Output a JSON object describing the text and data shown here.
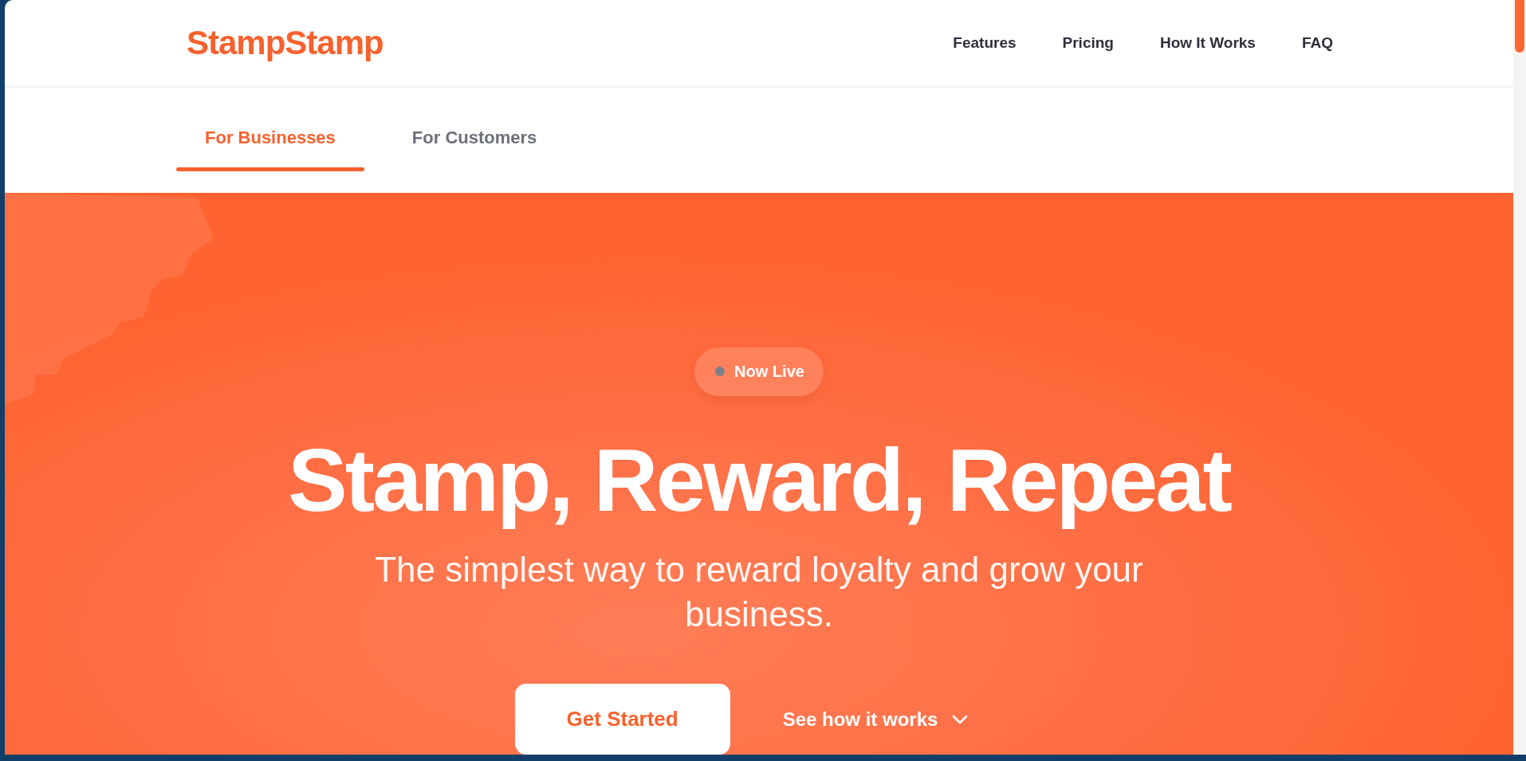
{
  "header": {
    "logo": "StampStamp",
    "nav": [
      "Features",
      "Pricing",
      "How It Works",
      "FAQ"
    ]
  },
  "tabs": [
    {
      "label": "For Businesses",
      "selected": true
    },
    {
      "label": "For Customers",
      "selected": false
    }
  ],
  "hero": {
    "badge": "Now Live",
    "headline": "Stamp, Reward, Repeat",
    "subtitle": "The simplest way to reward loyalty and grow your business.",
    "primary_button": "Get Started",
    "secondary_link": "See how it works"
  }
}
